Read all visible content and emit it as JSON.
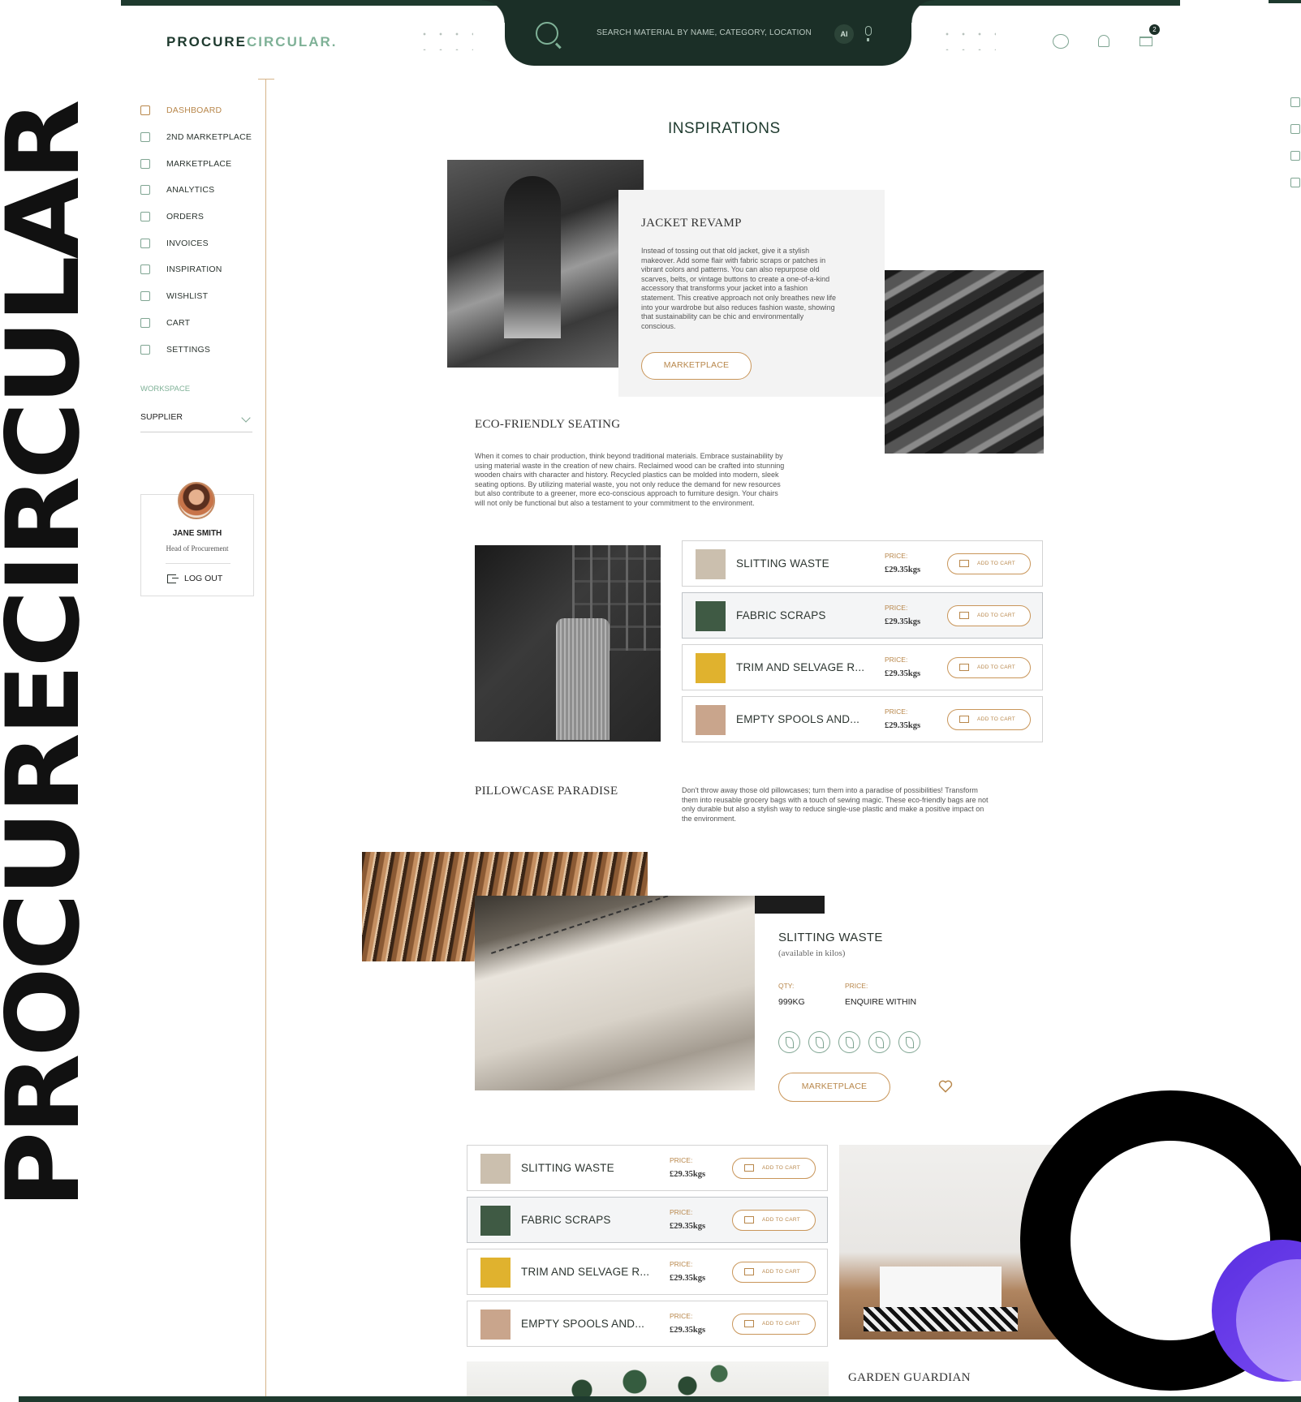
{
  "brand": {
    "logo_main": "PROCURE",
    "logo_accent": "CIRCULAR.",
    "side_text": "PROCURECIRCULAR"
  },
  "search": {
    "placeholder": "SEARCH MATERIAL BY NAME, CATEGORY, LOCATION",
    "ai_label": "AI"
  },
  "header": {
    "cart_count": "2"
  },
  "sidebar": {
    "items": [
      {
        "label": "DASHBOARD",
        "icon": "dashboard-icon",
        "active": true
      },
      {
        "label": "2ND MARKETPLACE",
        "icon": "recycle-marketplace-icon"
      },
      {
        "label": "MARKETPLACE",
        "icon": "store-icon"
      },
      {
        "label": "ANALYTICS",
        "icon": "bar-chart-icon"
      },
      {
        "label": "ORDERS",
        "icon": "shopping-bag-icon"
      },
      {
        "label": "INVOICES",
        "icon": "invoice-icon"
      },
      {
        "label": "INSPIRATION",
        "icon": "globe-icon"
      },
      {
        "label": "WISHLIST",
        "icon": "wishlist-icon"
      },
      {
        "label": "CART",
        "icon": "cart-icon"
      },
      {
        "label": "SETTINGS",
        "icon": "gear-icon"
      }
    ],
    "workspace_label": "WORKSPACE",
    "workspace_value": "SUPPLIER"
  },
  "profile": {
    "name": "JANE SMITH",
    "role": "Head of Procurement",
    "logout": "LOG OUT"
  },
  "main": {
    "title": "INSPIRATIONS",
    "jacket": {
      "title": "JACKET REVAMP",
      "body": "Instead of tossing out that old jacket, give it a stylish makeover. Add some flair with fabric scraps or patches in vibrant colors and patterns. You can also repurpose old scarves, belts, or vintage buttons to create a one-of-a-kind accessory that transforms your jacket into a fashion statement. This creative approach not only breathes new life into your wardrobe but also reduces fashion waste, showing that sustainability can be chic and environmentally conscious.",
      "button": "MARKETPLACE"
    },
    "seating": {
      "title": "ECO-FRIENDLY SEATING",
      "body": "When it comes to chair production, think beyond traditional materials. Embrace sustainability by using material waste in the creation of new chairs. Reclaimed wood can be crafted into stunning wooden chairs with character and history. Recycled plastics can be molded into modern, sleek seating options. By utilizing material waste, you not only reduce the demand for new resources but also contribute to a greener, more eco-conscious approach to furniture design. Your chairs will not only be functional but also a testament to your commitment to the environment."
    },
    "products_a": [
      {
        "name": "SLITTING WASTE",
        "price_label": "PRICE:",
        "price": "£29.35kgs",
        "cta": "ADD TO CART",
        "thumb_color": "#cbbfae"
      },
      {
        "name": "FABRIC SCRAPS",
        "price_label": "PRICE:",
        "price": "£29.35kgs",
        "cta": "ADD TO CART",
        "thumb_color": "#3f5a44"
      },
      {
        "name": "TRIM AND SELVAGE R...",
        "price_label": "PRICE:",
        "price": "£29.35kgs",
        "cta": "ADD TO CART",
        "thumb_color": "#e0b22e"
      },
      {
        "name": "EMPTY SPOOLS AND...",
        "price_label": "PRICE:",
        "price": "£29.35kgs",
        "cta": "ADD TO CART",
        "thumb_color": "#c9a58c"
      }
    ],
    "pillowcase": {
      "title": "PILLOWCASE PARADISE",
      "body": "Don't throw away those old pillowcases; turn them into a paradise of possibilities! Transform them into reusable grocery bags with a touch of sewing magic. These eco-friendly bags are not only durable but also a stylish way to reduce single-use plastic and make a positive impact on the environment."
    },
    "detail": {
      "title": "SLITTING WASTE",
      "subtitle": "(available in kilos)",
      "qty_label": "QTY:",
      "qty_value": "999KG",
      "price_label": "PRICE:",
      "price_value": "ENQUIRE WITHIN",
      "button": "MARKETPLACE",
      "eco_icons": [
        "eco-leaf-icon",
        "sprout-icon",
        "plant-icon",
        "leaves-icon",
        "hand-plant-icon"
      ]
    },
    "products_b": [
      {
        "name": "SLITTING WASTE",
        "price_label": "PRICE:",
        "price": "£29.35kgs",
        "cta": "ADD TO CART",
        "thumb_color": "#cbbfae"
      },
      {
        "name": "FABRIC SCRAPS",
        "price_label": "PRICE:",
        "price": "£29.35kgs",
        "cta": "ADD TO CART",
        "thumb_color": "#3f5a44"
      },
      {
        "name": "TRIM AND SELVAGE R...",
        "price_label": "PRICE:",
        "price": "£29.35kgs",
        "cta": "ADD TO CART",
        "thumb_color": "#e0b22e"
      },
      {
        "name": "EMPTY SPOOLS AND...",
        "price_label": "PRICE:",
        "price": "£29.35kgs",
        "cta": "ADD TO CART",
        "thumb_color": "#c9a58c"
      }
    ],
    "garden": {
      "title": "GARDEN GUARDIAN"
    }
  },
  "colors": {
    "primary_dark": "#1b2f27",
    "accent_green": "#7fb197",
    "accent_gold": "#b8874b",
    "violet": "#6a3cf0"
  }
}
